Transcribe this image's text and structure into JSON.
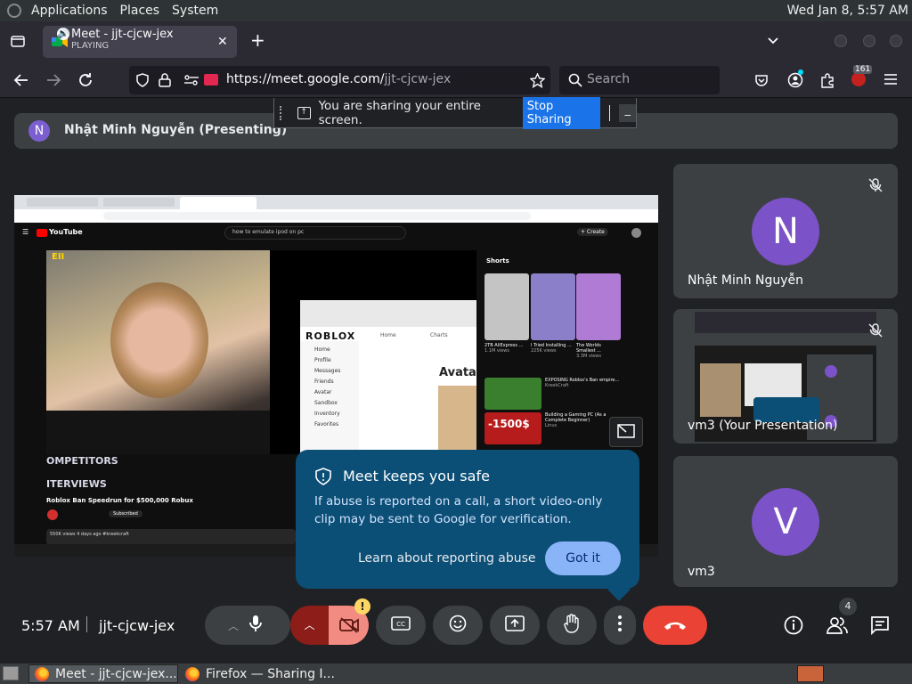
{
  "os_topbar": {
    "menus": [
      "Applications",
      "Places",
      "System"
    ],
    "clock": "Wed Jan  8,  5:57 AM"
  },
  "browser": {
    "tab": {
      "title": "Meet - jjt-cjcw-jex",
      "status": "PLAYING"
    },
    "url": {
      "host": "https://meet.google.com/",
      "path": "jjt-cjcw-jex"
    },
    "search_placeholder": "Search",
    "extension_badge": "161"
  },
  "meet": {
    "presenter_bar": {
      "avatar_letter": "N",
      "text": "Nhật Minh Nguyễn (Presenting)"
    },
    "share_banner": {
      "text": "You are sharing your entire screen.",
      "stop_label": "Stop Sharing",
      "minimize_label": "_"
    },
    "presentation": {
      "site_name": "YouTube",
      "search_query": "how to emulate ipod on pc",
      "shorts_label": "Shorts",
      "video_title": "Roblox Ban Speedrun for $500,000 Robux",
      "video_meta": "550K views  4 days ago #kreekcraft",
      "subscribed_label": "Subscribed",
      "overlay_lines": [
        "OMPETITORS",
        "ITERVIEWS"
      ],
      "inner_window": {
        "brand": "ROBLOX",
        "nav": [
          "Home",
          "Profile",
          "Messages",
          "Friends",
          "Avatar",
          "Sandbox",
          "Inventory",
          "Favorites"
        ],
        "tabs": [
          "Home",
          "Charts"
        ],
        "heading": "Avatar"
      },
      "shorts": [
        {
          "title": "2TB AliExpress ...",
          "meta": "1.1M views"
        },
        {
          "title": "I Tried Installing ...",
          "meta": "225K views"
        },
        {
          "title": "The Worlds Smallest ...",
          "meta": "3.3M views"
        }
      ],
      "side_videos": [
        {
          "title": "EXPOSING Roblox's Ban empire...",
          "meta": "KreekCraft"
        },
        {
          "title": "Building a Gaming PC (As a Complete Beginner)",
          "meta": "Linus"
        }
      ],
      "price_tag": "-1500$"
    },
    "participants": [
      {
        "letter": "N",
        "name": "Nhật Minh Nguyễn",
        "muted": true
      },
      {
        "name": "vm3 (Your Presentation)",
        "muted": true
      },
      {
        "letter": "V",
        "name": "vm3",
        "muted": false
      }
    ],
    "popup": {
      "title": "Meet keeps you safe",
      "body": "If abuse is reported on a call, a short video-only clip may be sent to Google for verification.",
      "learn_link": "Learn about reporting abuse",
      "confirm_label": "Got it"
    },
    "controls": {
      "time": "5:57 AM",
      "meeting_code": "jjt-cjcw-jex",
      "camera_warning": "!",
      "people_count": "4"
    },
    "colors": {
      "accent_blue": "#1a73e8",
      "end_call_red": "#ea4335",
      "popup_bg": "#0b4e76",
      "got_it_bg": "#8ab4f8",
      "avatar_purple": "#7b52c8"
    }
  },
  "taskbar": {
    "items": [
      "Meet - jjt-cjcw-jex...",
      "Firefox — Sharing I..."
    ]
  }
}
